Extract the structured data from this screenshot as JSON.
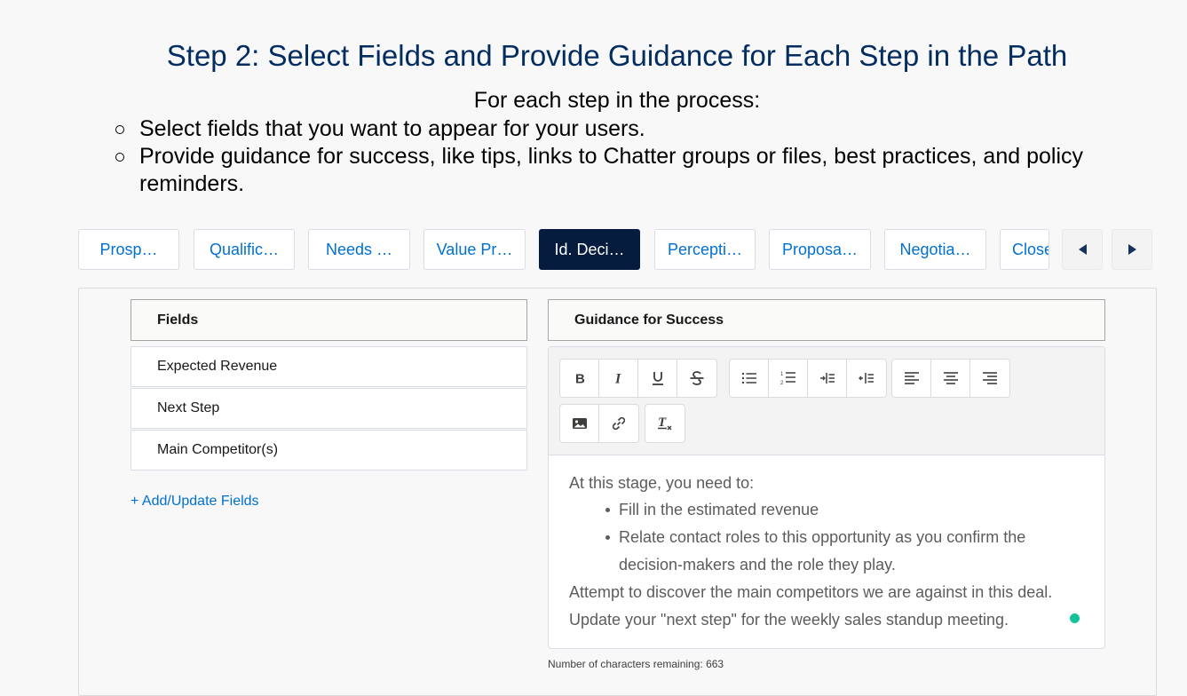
{
  "header": {
    "title": "Step 2: Select Fields and Provide Guidance for Each Step in the Path",
    "subtitle": "For each step in the process:",
    "bullets": [
      "Select fields that you want to appear for your users.",
      "Provide guidance for success, like tips, links to Chatter groups or files, best practices, and policy reminders."
    ]
  },
  "path": {
    "tabs": [
      {
        "label": "Prosp…",
        "active": false
      },
      {
        "label": "Qualific…",
        "active": false
      },
      {
        "label": "Needs …",
        "active": false
      },
      {
        "label": "Value Pr…",
        "active": false
      },
      {
        "label": "Id. Deci…",
        "active": true
      },
      {
        "label": "Percepti…",
        "active": false
      },
      {
        "label": "Proposa…",
        "active": false
      },
      {
        "label": "Negotia…",
        "active": false
      },
      {
        "label": "Close",
        "active": false
      }
    ],
    "prev_icon": "triangle-left-icon",
    "next_icon": "triangle-right-icon"
  },
  "fields": {
    "header": "Fields",
    "items": [
      "Expected Revenue",
      "Next Step",
      "Main Competitor(s)"
    ],
    "add_link": "+ Add/Update Fields"
  },
  "guidance": {
    "header": "Guidance for Success",
    "toolbar": {
      "row1": [
        [
          "bold-icon",
          "italic-icon",
          "underline-icon",
          "strikethrough-icon"
        ],
        [
          "bullet-list-icon",
          "numbered-list-icon",
          "indent-icon",
          "outdent-icon"
        ],
        [
          "align-left-icon",
          "align-center-icon",
          "align-right-icon"
        ]
      ],
      "row2": [
        [
          "image-icon",
          "link-icon"
        ],
        [
          "clear-formatting-icon"
        ]
      ]
    },
    "content": {
      "intro": "At this stage, you need to:",
      "bullets": [
        "Fill in the estimated revenue",
        "Relate contact roles to this opportunity as you confirm the decision-makers and the role they play."
      ],
      "line2": "Attempt to discover the main competitors we are against in this deal.",
      "line3": "Update your \"next step\" for the weekly sales standup meeting."
    },
    "counter": "Number of characters remaining: 663"
  },
  "colors": {
    "title": "#032d60",
    "link": "#0070d2",
    "active_tab": "#061c3f",
    "grammar_dot": "#15c39a"
  }
}
